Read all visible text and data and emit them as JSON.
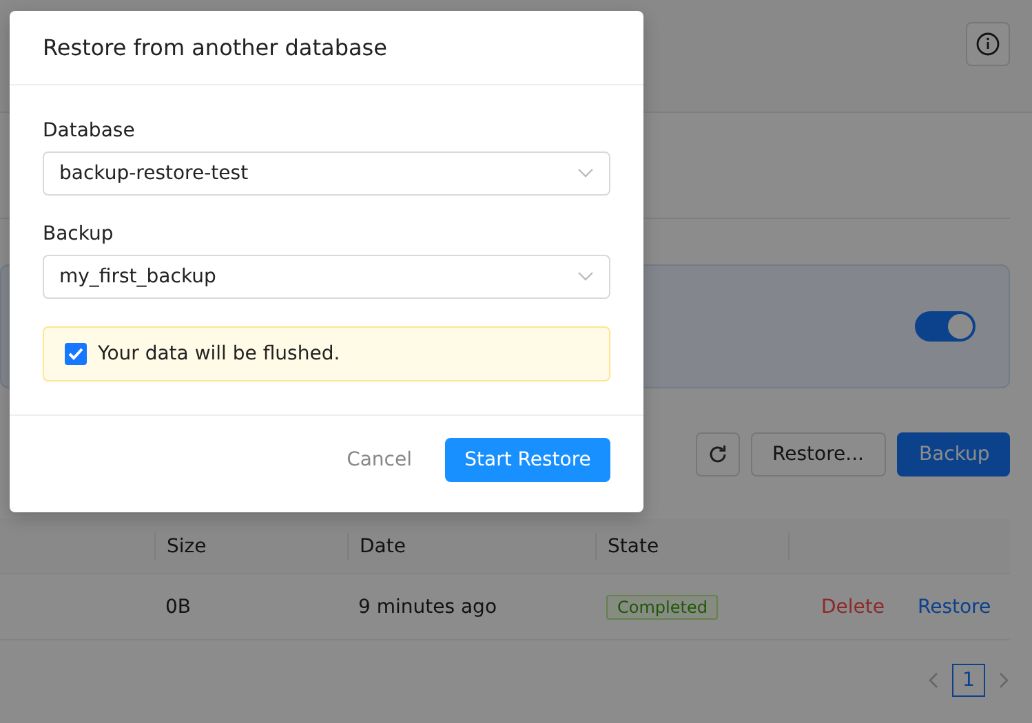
{
  "page": {
    "toggle": {
      "on": true
    },
    "toolbar": {
      "restore_button": "Restore...",
      "backup_button": "Backup"
    },
    "table": {
      "columns": [
        "Size",
        "Date",
        "State"
      ],
      "rows": [
        {
          "size": "0B",
          "date": "9 minutes ago",
          "state": "Completed",
          "actions": [
            "Delete",
            "Restore"
          ]
        }
      ]
    },
    "pagination": {
      "pages": [
        {
          "label": "1",
          "selected": true
        }
      ]
    }
  },
  "dialog": {
    "title": "Restore from another database",
    "fields": [
      {
        "label": "Database",
        "value": "backup-restore-test"
      },
      {
        "label": "Backup",
        "value": "my_first_backup"
      }
    ],
    "warning": {
      "text": "Your data will be flushed.",
      "checked": true
    },
    "buttons": [
      {
        "label": "Cancel",
        "kind": "text"
      },
      {
        "label": "Start Restore",
        "kind": "primary"
      }
    ]
  }
}
